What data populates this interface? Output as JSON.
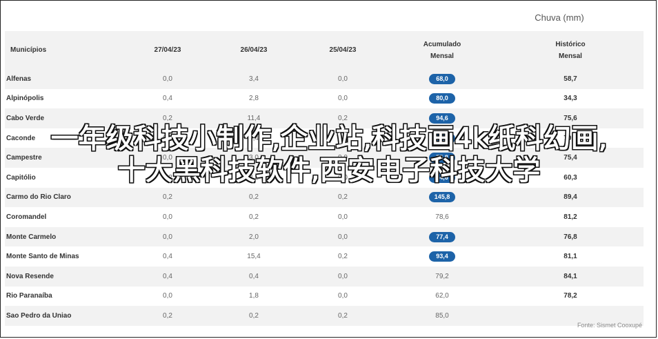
{
  "title": "Chuva (mm)",
  "columns": [
    "Municípios",
    "27/04/23",
    "26/04/23",
    "25/04/23",
    [
      "Acumulado",
      "Mensal"
    ],
    [
      "Histórico",
      "Mensal"
    ]
  ],
  "rows": [
    {
      "mun": "Alfenas",
      "c1": "0,0",
      "c2": "3,4",
      "c3": "0,0",
      "acc": "68,0",
      "pill": true,
      "hist": "58,7"
    },
    {
      "mun": "Alpinópolis",
      "c1": "0,4",
      "c2": "2,8",
      "c3": "0,0",
      "acc": "80,0",
      "pill": true,
      "hist": "34,3"
    },
    {
      "mun": "Cabo Verde",
      "c1": "0,2",
      "c2": "11,4",
      "c3": "0,2",
      "acc": "94,6",
      "pill": true,
      "hist": "75,6"
    },
    {
      "mun": "Caconde",
      "c1": "0,2",
      "c2": "5,4",
      "c3": "0,0",
      "acc": "82,5",
      "pill": true,
      "hist": "70,5"
    },
    {
      "mun": "Campestre",
      "c1": "0,0",
      "c2": "3,0",
      "c3": "0,0",
      "acc": "75,8",
      "pill": true,
      "hist": "75,4"
    },
    {
      "mun": "Capitólio",
      "c1": "0,2",
      "c2": "2,2",
      "c3": "0,0",
      "acc": "74,6",
      "pill": true,
      "hist": "60,3"
    },
    {
      "mun": "Carmo do Rio Claro",
      "c1": "0,2",
      "c2": "0,2",
      "c3": "0,2",
      "acc": "145,8",
      "pill": true,
      "hist": "89,4"
    },
    {
      "mun": "Coromandel",
      "c1": "0,0",
      "c2": "0,2",
      "c3": "0,0",
      "acc": "78,6",
      "pill": false,
      "hist": "81,2"
    },
    {
      "mun": "Monte Carmelo",
      "c1": "0,0",
      "c2": "2,0",
      "c3": "0,0",
      "acc": "77,4",
      "pill": true,
      "hist": "76,8"
    },
    {
      "mun": "Monte Santo de Minas",
      "c1": "0,4",
      "c2": "15,4",
      "c3": "0,2",
      "acc": "93,4",
      "pill": true,
      "hist": "81,1"
    },
    {
      "mun": "Nova Resende",
      "c1": "0,4",
      "c2": "0,4",
      "c3": "0,0",
      "acc": "79,2",
      "pill": false,
      "hist": "84,1"
    },
    {
      "mun": "Rio Paranaíba",
      "c1": "0,0",
      "c2": "1,8",
      "c3": "0,0",
      "acc": "62,0",
      "pill": false,
      "hist": "78,2"
    },
    {
      "mun": "Sao Pedro da Uniao",
      "c1": "0,2",
      "c2": "0,2",
      "c3": "0,2",
      "acc": "85,0",
      "pill": false,
      "hist": ""
    }
  ],
  "source": "Fonte: Sismet Cooxupé",
  "overlay_text": "一年级科技小制作,企业站,科技画4k纸科幻画,十大黑科技软件,西安电子科技大学",
  "colors": {
    "pill": "#1d63a8",
    "stripe": "#f2f2f2"
  }
}
